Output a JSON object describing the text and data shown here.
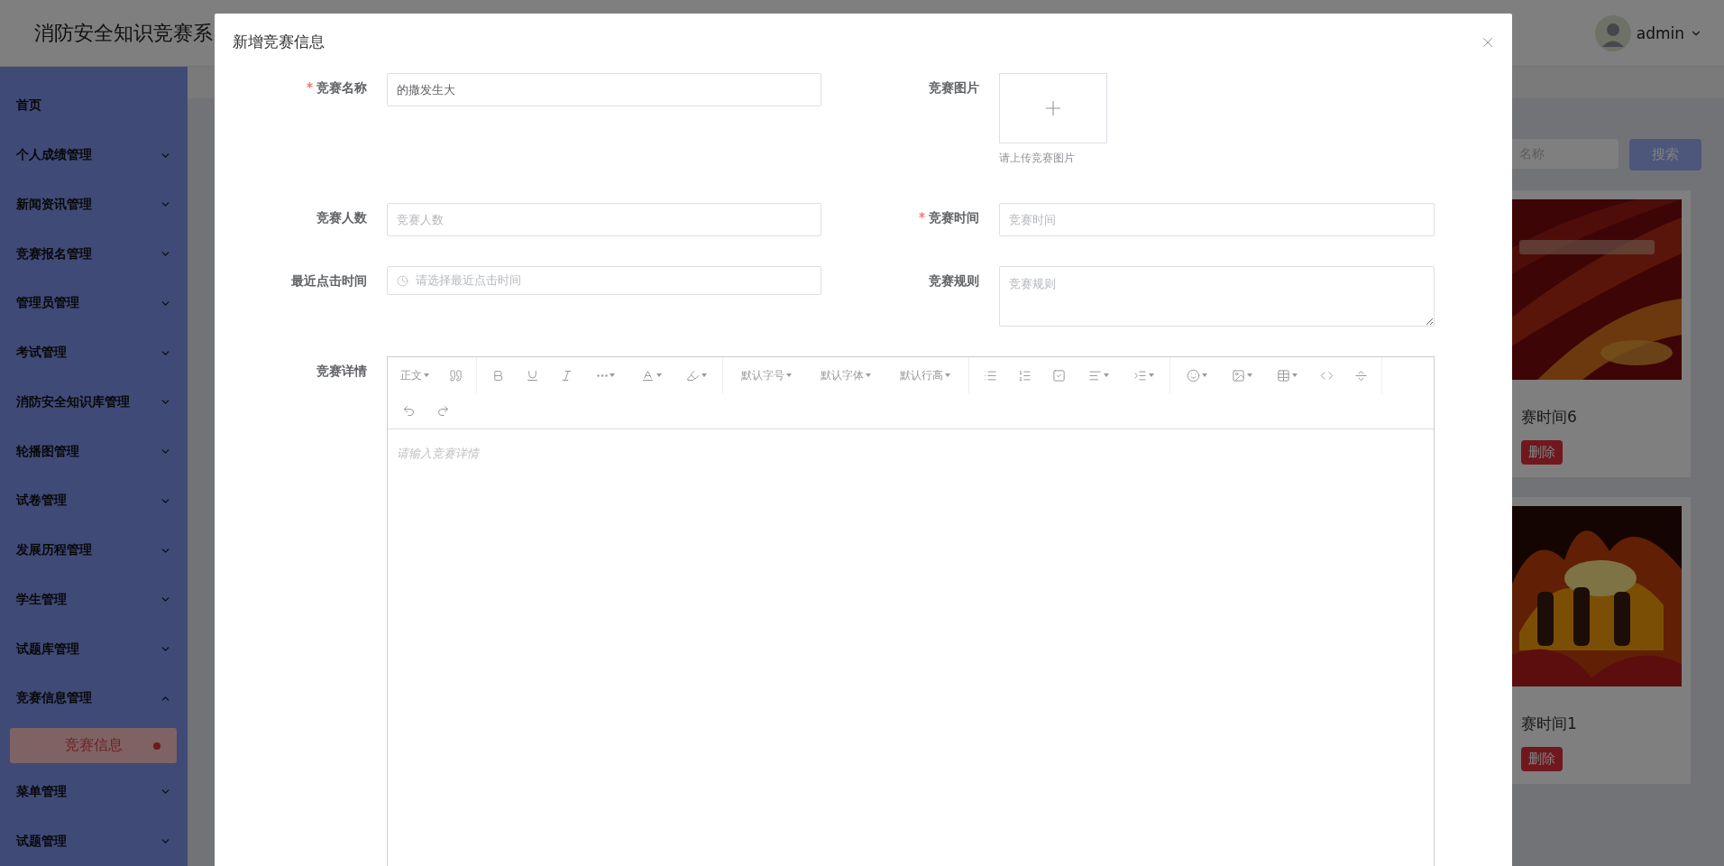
{
  "header": {
    "title": "消防安全知识竞赛系",
    "user": "admin"
  },
  "sidebar": {
    "items": [
      {
        "label": "首页",
        "kind": "link",
        "selected": false
      },
      {
        "label": "个人成绩管理",
        "kind": "group",
        "expanded": false,
        "selected": false
      },
      {
        "label": "新闻资讯管理",
        "kind": "group",
        "expanded": false,
        "selected": false
      },
      {
        "label": "竞赛报名管理",
        "kind": "group",
        "expanded": false,
        "selected": false
      },
      {
        "label": "管理员管理",
        "kind": "group",
        "expanded": false,
        "selected": false
      },
      {
        "label": "考试管理",
        "kind": "group",
        "expanded": false,
        "selected": false
      },
      {
        "label": "消防安全知识库管理",
        "kind": "group",
        "expanded": false,
        "selected": false
      },
      {
        "label": "轮播图管理",
        "kind": "group",
        "expanded": false,
        "selected": false
      },
      {
        "label": "试卷管理",
        "kind": "group",
        "expanded": false,
        "selected": false
      },
      {
        "label": "发展历程管理",
        "kind": "group",
        "expanded": false,
        "selected": false
      },
      {
        "label": "学生管理",
        "kind": "group",
        "expanded": false,
        "selected": false
      },
      {
        "label": "试题库管理",
        "kind": "group",
        "expanded": false,
        "selected": false
      },
      {
        "label": "竞赛信息管理",
        "kind": "group",
        "expanded": true,
        "selected": false,
        "children": [
          {
            "label": "竞赛信息",
            "selected": true
          }
        ]
      },
      {
        "label": "菜单管理",
        "kind": "group",
        "expanded": false,
        "selected": false
      },
      {
        "label": "试题管理",
        "kind": "group",
        "expanded": false,
        "selected": false
      }
    ]
  },
  "search": {
    "placeholder": "名称",
    "button": "搜索"
  },
  "cards": [
    {
      "title": "赛时间6",
      "action": "删除"
    },
    {
      "title": "赛时间1",
      "action": "删除"
    }
  ],
  "modal": {
    "title": "新增竞赛信息",
    "fields": [
      {
        "label": "竞赛名称",
        "kind": "text",
        "required": true,
        "value": "的撒发生大"
      },
      {
        "label": "竞赛图片",
        "kind": "upload",
        "required": false,
        "hint": "请上传竞赛图片"
      },
      {
        "label": "竞赛人数",
        "kind": "text",
        "required": false,
        "placeholder": "竞赛人数"
      },
      {
        "label": "竞赛时间",
        "kind": "text",
        "required": true,
        "placeholder": "竞赛时间"
      },
      {
        "label": "最近点击时间",
        "kind": "date",
        "required": false,
        "placeholder": "请选择最近点击时间"
      },
      {
        "label": "竞赛规则",
        "kind": "textarea",
        "required": false,
        "placeholder": "竞赛规则"
      },
      {
        "label": "竞赛详情",
        "kind": "editor",
        "required": false,
        "placeholder": "请输入竞赛详情",
        "toolbar_labels": [
          "正文",
          "默认字号",
          "默认字体",
          "默认行高"
        ]
      }
    ]
  }
}
